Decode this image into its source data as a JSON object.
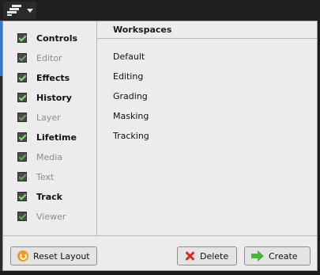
{
  "topbar": {
    "menu_icon": "workspaces-icon",
    "chevron_icon": "chevron-down-icon"
  },
  "panels": [
    {
      "label": "Controls",
      "checked": true,
      "enabled": true
    },
    {
      "label": "Editor",
      "checked": true,
      "enabled": false
    },
    {
      "label": "Effects",
      "checked": true,
      "enabled": true
    },
    {
      "label": "History",
      "checked": true,
      "enabled": true
    },
    {
      "label": "Layer",
      "checked": true,
      "enabled": false
    },
    {
      "label": "Lifetime",
      "checked": true,
      "enabled": true
    },
    {
      "label": "Media",
      "checked": true,
      "enabled": false
    },
    {
      "label": "Text",
      "checked": true,
      "enabled": false
    },
    {
      "label": "Track",
      "checked": true,
      "enabled": true
    },
    {
      "label": "Viewer",
      "checked": true,
      "enabled": false
    }
  ],
  "workspaces": {
    "header": "Workspaces",
    "items": [
      "Default",
      "Editing",
      "Grading",
      "Masking",
      "Tracking"
    ]
  },
  "footer": {
    "reset_label": "Reset Layout",
    "delete_label": "Delete",
    "create_label": "Create"
  },
  "colors": {
    "check": "#7fe36a",
    "delete_icon": "#d92a1c",
    "create_icon": "#4bb33a",
    "reset_icon": "#f29a1d"
  }
}
